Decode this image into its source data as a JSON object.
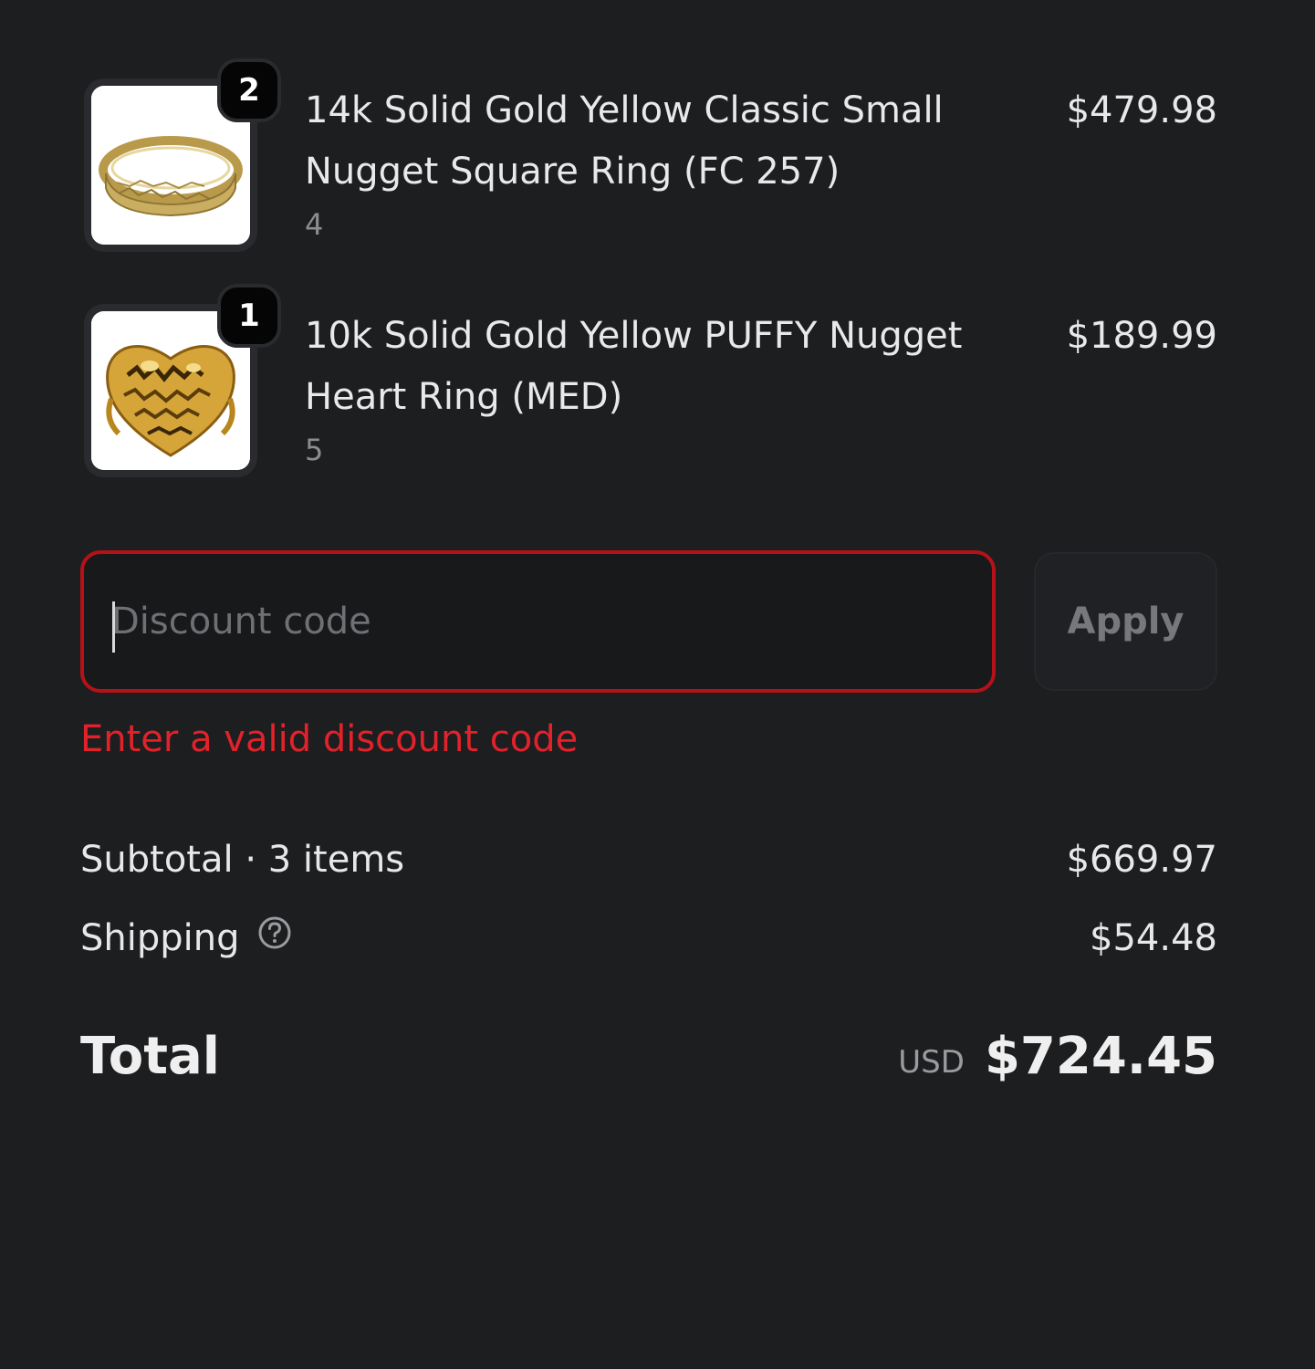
{
  "line_items": [
    {
      "quantity": "2",
      "title": "14k Solid Gold Yellow Classic Small Nugget Square Ring (FC 257)",
      "variant": "4",
      "price": "$479.98"
    },
    {
      "quantity": "1",
      "title": "10k Solid Gold Yellow PUFFY Nugget Heart Ring (MED)",
      "variant": "5",
      "price": "$189.99"
    }
  ],
  "discount": {
    "placeholder": "Discount code",
    "value": "",
    "apply_label": "Apply",
    "error": "Enter a valid discount code"
  },
  "summary": {
    "subtotal_label": "Subtotal · 3 items",
    "subtotal_value": "$669.97",
    "shipping_label": "Shipping",
    "shipping_value": "$54.48",
    "total_label": "Total",
    "currency": "USD",
    "total_value": "$724.45"
  },
  "icons": {
    "shipping_help": "question-circle-icon"
  },
  "colors": {
    "background": "#1d1e20",
    "error": "#e2222a",
    "error_border": "#b51218"
  }
}
